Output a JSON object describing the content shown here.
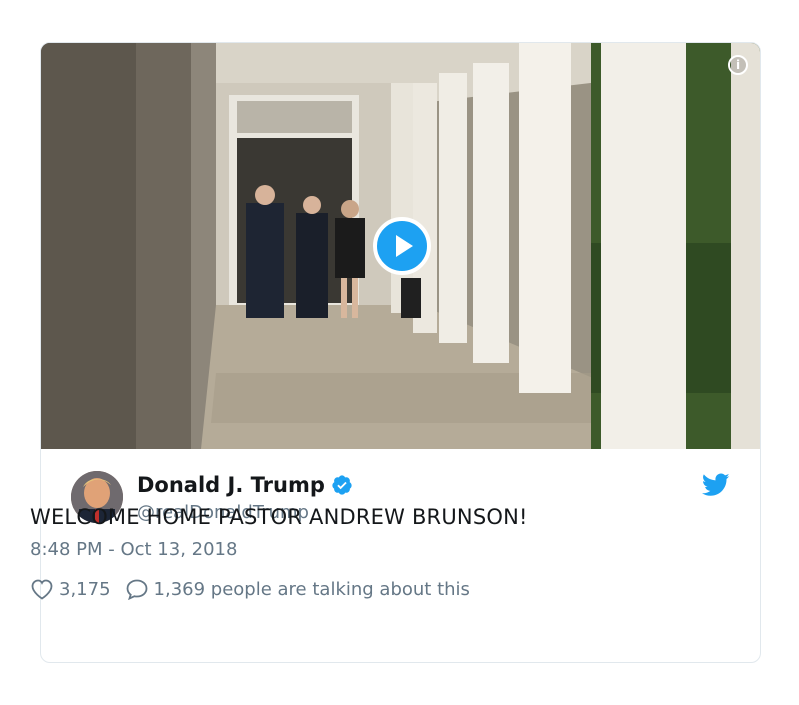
{
  "tweet": {
    "author": {
      "display_name": "Donald J. Trump",
      "handle": "@realDonaldTrump",
      "verified": true
    },
    "text": "WELCOME HOME PASTOR ANDREW BRUNSON!",
    "timestamp": "8:48 PM - Oct 13, 2018",
    "likes": "3,175",
    "conversation": "1,369 people are talking about this"
  },
  "media": {
    "type": "video",
    "icons": [
      "play-icon",
      "info-icon"
    ]
  },
  "colors": {
    "accent": "#1da1f2",
    "text": "#14171a",
    "secondary": "#657786",
    "border": "#e1e8ed"
  }
}
